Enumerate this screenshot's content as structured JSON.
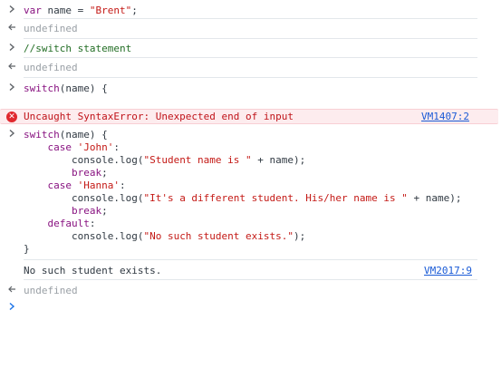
{
  "entries": [
    {
      "type": "input",
      "text": "var name = \"Brent\";"
    },
    {
      "type": "result",
      "text": "undefined"
    },
    {
      "type": "input",
      "text": "//switch statement"
    },
    {
      "type": "result",
      "text": "undefined"
    },
    {
      "type": "input",
      "text": "switch(name) {"
    },
    {
      "type": "error",
      "text": "Uncaught SyntaxError: Unexpected end of input",
      "source": "VM1407:2"
    },
    {
      "type": "input_multiline",
      "lines": [
        "switch(name) {",
        "    case 'John':",
        "        console.log(\"Student name is \" + name);",
        "        break;",
        "    case 'Hanna':",
        "        console.log(\"It's a different student. His/her name is \" + name);",
        "        break;",
        "    default:",
        "        console.log(\"No such student exists.\");",
        "}"
      ]
    },
    {
      "type": "log",
      "text": "No such student exists.",
      "source": "VM2017:9"
    },
    {
      "type": "result",
      "text": "undefined"
    }
  ],
  "prompt_symbol": ">",
  "result_symbol": "<"
}
